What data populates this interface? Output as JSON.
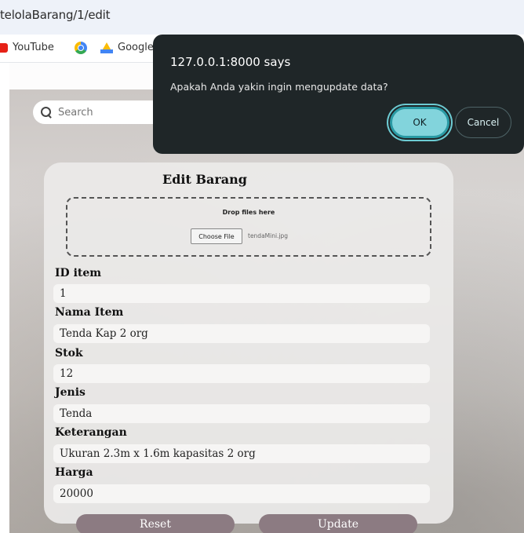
{
  "browser": {
    "url": "telolaBarang/1/edit",
    "bookmarks": [
      {
        "label": "YouTube",
        "icon": "youtube-icon"
      },
      {
        "label": "",
        "icon": "chrome-icon"
      },
      {
        "label": "Google",
        "icon": "google-drive-icon"
      }
    ]
  },
  "search": {
    "placeholder": "Search"
  },
  "dialog": {
    "title": "127.0.0.1:8000 says",
    "message": "Apakah Anda yakin ingin mengupdate data?",
    "ok_label": "OK",
    "cancel_label": "Cancel"
  },
  "form": {
    "title": "Edit Barang",
    "dropzone_label": "Drop files here",
    "choose_file_label": "Choose File",
    "file_name": "tendaMini.jpg",
    "fields": [
      {
        "label": "ID item",
        "value": "1"
      },
      {
        "label": "Nama Item",
        "value": "Tenda Kap 2 org"
      },
      {
        "label": "Stok",
        "value": "12"
      },
      {
        "label": "Jenis",
        "value": "Tenda"
      },
      {
        "label": "Keterangan",
        "value": "Ukuran 2.3m x 1.6m kapasitas 2 org"
      },
      {
        "label": "Harga",
        "value": "20000"
      }
    ],
    "reset_label": "Reset",
    "update_label": "Update"
  },
  "colors": {
    "dialog_bg": "#1f2628",
    "ok_button": "#82d4dc",
    "action_button": "#8c7b82"
  }
}
